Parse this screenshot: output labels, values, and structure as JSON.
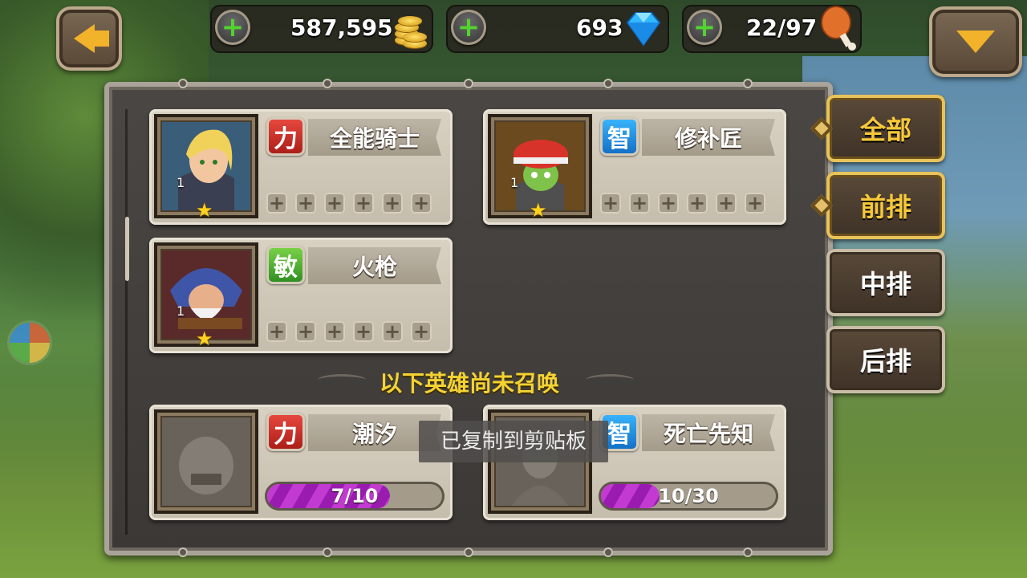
{
  "resources": {
    "gold": "587,595",
    "gems": "693",
    "stamina": "22/97"
  },
  "tabs": [
    {
      "label": "全部",
      "active": true
    },
    {
      "label": "前排",
      "active": true
    },
    {
      "label": "中排",
      "active": false
    },
    {
      "label": "后排",
      "active": false
    }
  ],
  "owned_heroes": [
    {
      "name": "全能骑士",
      "attr": "力",
      "level": "1",
      "stars": 1,
      "equip_slots": 6
    },
    {
      "name": "修补匠",
      "attr": "智",
      "level": "1",
      "stars": 1,
      "equip_slots": 6
    },
    {
      "name": "火枪",
      "attr": "敏",
      "level": "1",
      "stars": 1,
      "equip_slots": 6
    }
  ],
  "section_label": "以下英雄尚未召唤",
  "unsummoned_heroes": [
    {
      "name": "潮汐",
      "attr": "力",
      "progress_text": "7/10",
      "progress": 0.7
    },
    {
      "name": "死亡先知",
      "attr": "智",
      "progress_text": "10/30",
      "progress": 0.333
    }
  ],
  "toast": "已复制到剪贴板",
  "icons": {
    "slot": "+",
    "plus": "+",
    "star": "★"
  },
  "colors": {
    "accent": "#f7c93a",
    "plus_green": "#52d42e",
    "progress": "#b62bc8",
    "str": "#d4322a",
    "int": "#1e8fe0",
    "agi": "#3fae2f"
  }
}
